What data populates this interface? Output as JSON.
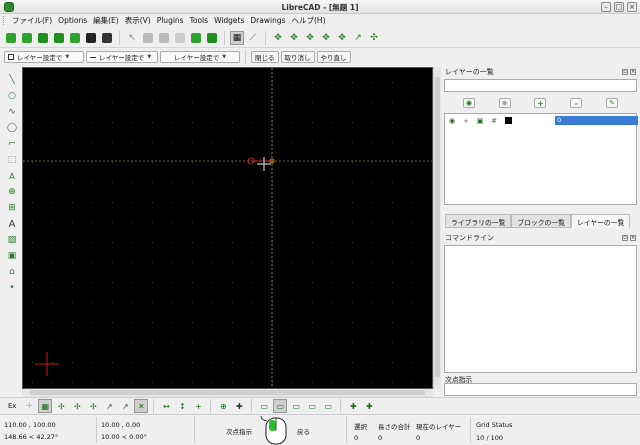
{
  "window": {
    "title": "LibreCAD - [無題 1]"
  },
  "menubar": {
    "items": [
      "ファイル(F)",
      "Options",
      "編集(E)",
      "表示(V)",
      "Plugins",
      "Tools",
      "Widgets",
      "Drawings",
      "ヘルプ(H)"
    ]
  },
  "pen_toolbar": {
    "color_combo": "レイヤー設定で",
    "width_combo": "レイヤー設定で",
    "type_combo": "レイヤー設定で",
    "close_button": "閉じる",
    "undo_button": "取り消し",
    "redo_button": "やり直し"
  },
  "layer_panel": {
    "title": "レイヤーの一覧",
    "layer_name": "0"
  },
  "tabs": [
    "ライブラリの一覧",
    "ブロックの一覧",
    "レイヤーの一覧"
  ],
  "command_panel": {
    "title": "コマンドライン",
    "prompt_label": "次点指示"
  },
  "snap_toolbar": {
    "label": "Ex"
  },
  "status": {
    "abs_coord": "110.00 , 100.00",
    "abs_polar": "148.66 < 42.27°",
    "rel_coord": "10.00 , 0.00",
    "rel_polar": "10.00 < 0.00°",
    "mouse_left": "次点指示",
    "mouse_right": "戻る",
    "selected_label": "選択",
    "selected_value": "0",
    "length_label": "長さの合計",
    "length_value": "0",
    "current_layer_label": "現在のレイヤー",
    "current_layer_value": "0",
    "grid_label": "Grid Status",
    "grid_value": "10 / 100"
  },
  "colors": {
    "canvas": "#000000",
    "crosshair": "#ff0000",
    "guide": "#ffd060",
    "selection": "#3a7bd5"
  }
}
